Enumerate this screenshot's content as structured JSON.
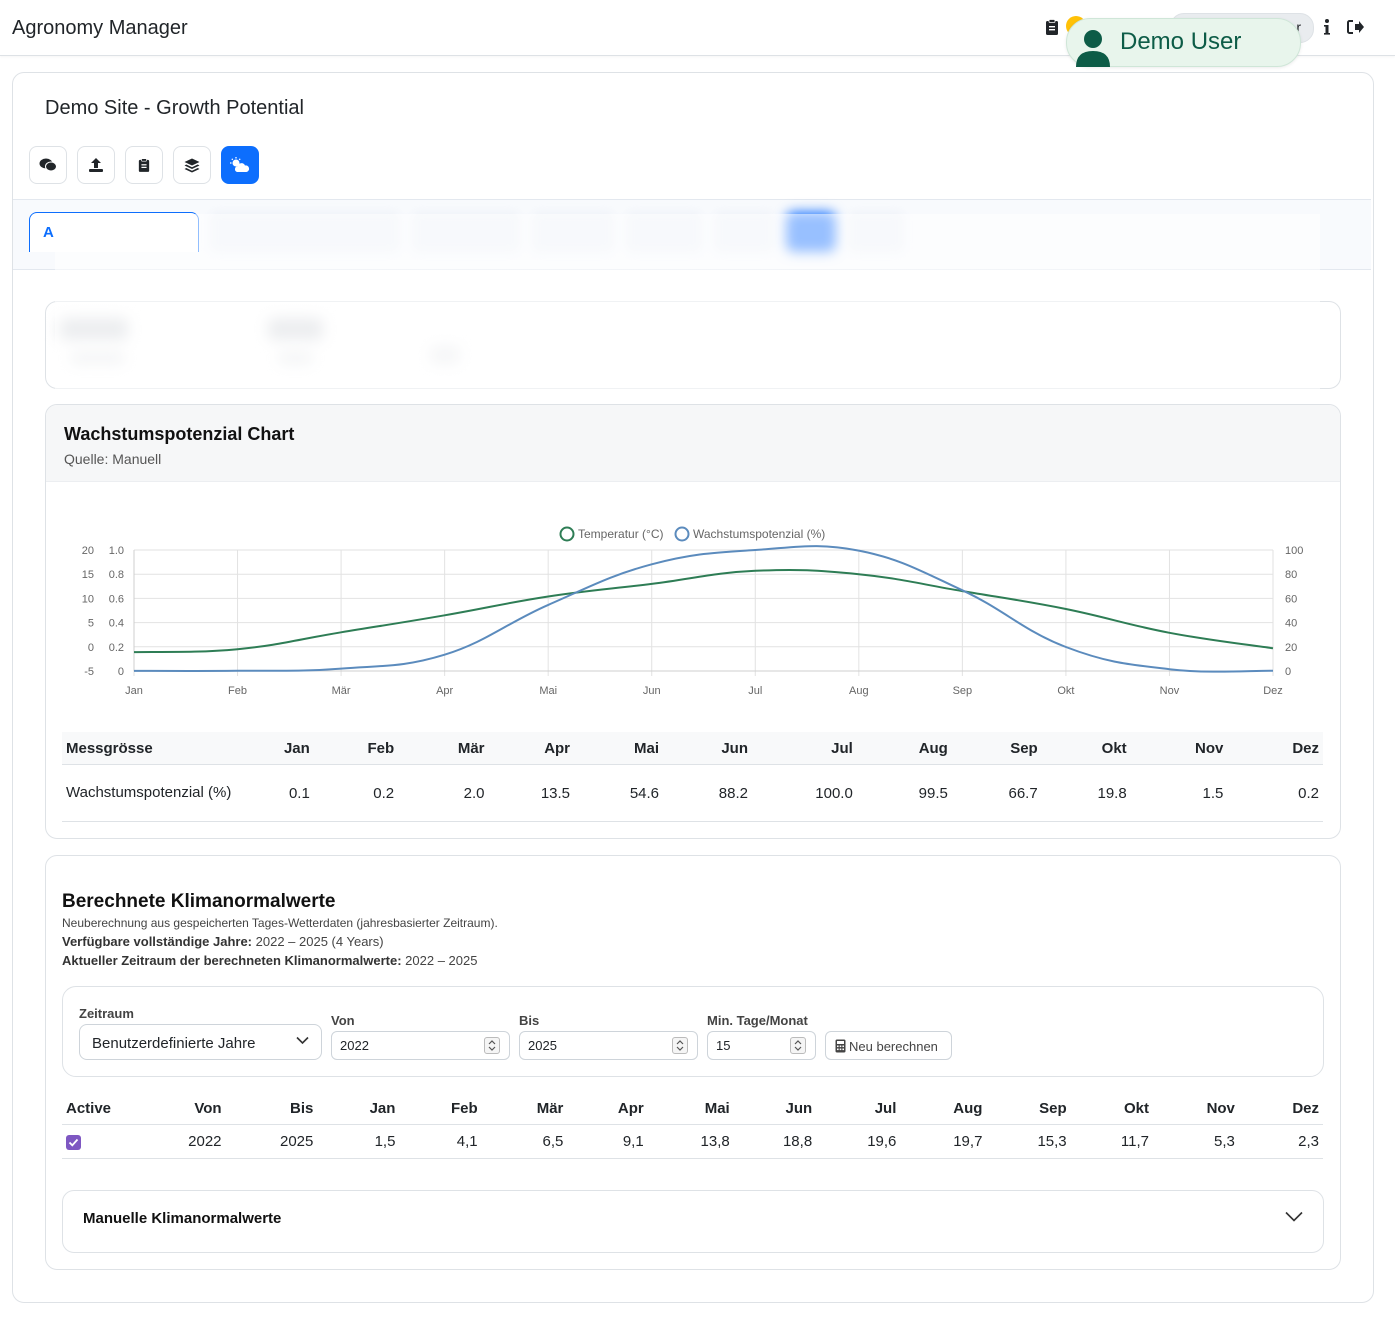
{
  "app": {
    "title": "Agronomy Manager",
    "user": {
      "name": "Demo User",
      "badge_text_partial": "r"
    },
    "icons": [
      "clipboard-icon",
      "info-icon",
      "logout-icon",
      "user-icon"
    ]
  },
  "page": {
    "title": "Demo Site - Growth Potential",
    "toolbar": [
      {
        "name": "comments-button",
        "icon": "comments-icon",
        "active": false
      },
      {
        "name": "upload-button",
        "icon": "upload-icon",
        "active": false
      },
      {
        "name": "clipboard-button",
        "icon": "clipboard-icon",
        "active": false
      },
      {
        "name": "layers-button",
        "icon": "layers-icon",
        "active": false
      },
      {
        "name": "weather-button",
        "icon": "cloud-sun-icon",
        "active": true
      }
    ],
    "first_tab_letter": "A"
  },
  "chart_card": {
    "title": "Wachstumspotenzial Chart",
    "source": "Quelle: Manuell"
  },
  "chart_data": {
    "type": "line",
    "categories": [
      "Jan",
      "Feb",
      "Mär",
      "Apr",
      "Mai",
      "Jun",
      "Jul",
      "Aug",
      "Sep",
      "Okt",
      "Nov",
      "Dez"
    ],
    "series": [
      {
        "name": "Temperatur (°C)",
        "axis": "left",
        "color": "#2e7d55",
        "values": [
          -1.1,
          -0.5,
          3.0,
          6.5,
          10.4,
          13.0,
          15.7,
          15.0,
          11.5,
          7.8,
          2.9,
          -0.3
        ]
      },
      {
        "name": "Wachstumspotenzial (%)",
        "axis": "right",
        "color": "#5b8bbd",
        "values": [
          0.1,
          0.2,
          2.0,
          13.5,
          54.6,
          88.2,
          100.0,
          99.5,
          66.7,
          19.8,
          1.5,
          0.2
        ]
      }
    ],
    "y_left": {
      "min": -5,
      "max": 20,
      "ticks": [
        "20",
        "15",
        "10",
        "5",
        "0",
        "-5"
      ]
    },
    "y_left2": {
      "min": 0,
      "max": 1,
      "ticks": [
        "1.0",
        "0.8",
        "0.6",
        "0.4",
        "0.2",
        "0"
      ]
    },
    "y_right": {
      "min": 0,
      "max": 100,
      "ticks": [
        "100",
        "80",
        "60",
        "40",
        "20",
        "0"
      ]
    },
    "grid": true,
    "legend": "top-center"
  },
  "growth_table": {
    "header": "Messgrösse",
    "months": [
      "Jan",
      "Feb",
      "Mär",
      "Apr",
      "Mai",
      "Jun",
      "Jul",
      "Aug",
      "Sep",
      "Okt",
      "Nov",
      "Dez"
    ],
    "row_label": "Wachstumspotenzial (%)",
    "values": [
      "0.1",
      "0.2",
      "2.0",
      "13.5",
      "54.6",
      "88.2",
      "100.0",
      "99.5",
      "66.7",
      "19.8",
      "1.5",
      "0.2"
    ]
  },
  "climate": {
    "title": "Berechnete Klimanormalwerte",
    "description": "Neuberechnung aus gespeicherten Tages-Wetterdaten (jahresbasierter Zeitraum).",
    "available_label": "Verfügbare vollständige Jahre:",
    "available_value": "2022 – 2025  (4 Years)",
    "current_label": "Aktueller Zeitraum der berechneten Klimanormalwerte:",
    "current_value": "2022 – 2025",
    "form": {
      "period_label": "Zeitraum",
      "period_value": "Benutzerdefinierte Jahre",
      "from_label": "Von",
      "from_value": "2022",
      "to_label": "Bis",
      "to_value": "2025",
      "min_days_label": "Min. Tage/Monat",
      "min_days_value": "15",
      "recalc_label": "Neu berechnen"
    },
    "table": {
      "headers": [
        "Active",
        "Von",
        "Bis",
        "Jan",
        "Feb",
        "Mär",
        "Apr",
        "Mai",
        "Jun",
        "Jul",
        "Aug",
        "Sep",
        "Okt",
        "Nov",
        "Dez"
      ],
      "rows": [
        {
          "active": true,
          "cells": [
            "2022",
            "2025",
            "1,5",
            "4,1",
            "6,5",
            "9,1",
            "13,8",
            "18,8",
            "19,6",
            "19,7",
            "15,3",
            "11,7",
            "5,3",
            "2,3"
          ]
        }
      ]
    },
    "manual_label": "Manuelle Klimanormalwerte"
  },
  "colors": {
    "accent": "#0d6efd",
    "temp": "#2e7d55",
    "growth": "#5b8bbd",
    "checkbox": "#7e57c2",
    "user_pill": "#e8f5ec"
  }
}
